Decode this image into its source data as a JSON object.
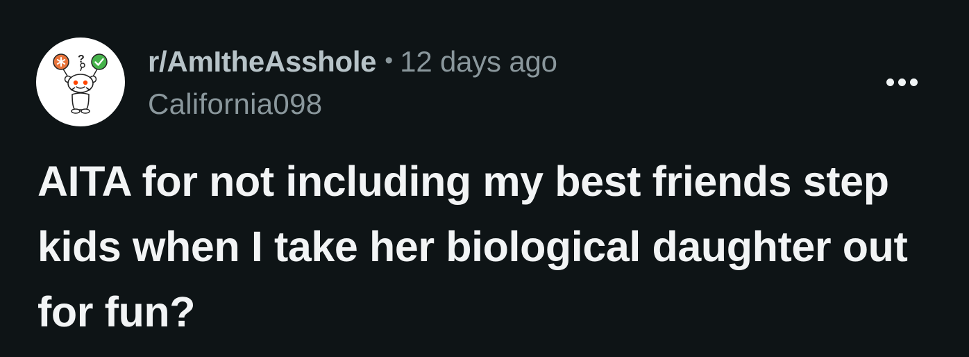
{
  "post": {
    "subreddit": "r/AmItheAsshole",
    "separator": "•",
    "time_ago": "12 days ago",
    "author": "California098",
    "title": "AITA for not including my best friends step kids when I take her biological daughter out for fun?"
  },
  "icons": {
    "avatar": "snoo-holding-balloons-icon",
    "overflow": "more-horizontal-icon"
  },
  "colors": {
    "background": "#0e1416",
    "title_text": "#f2f4f5",
    "meta_text": "#8a979c",
    "subreddit_text": "#b7c3c8",
    "balloon_orange": "#e8743b",
    "balloon_green": "#46b34b",
    "snoo_eyes": "#ff4500"
  }
}
